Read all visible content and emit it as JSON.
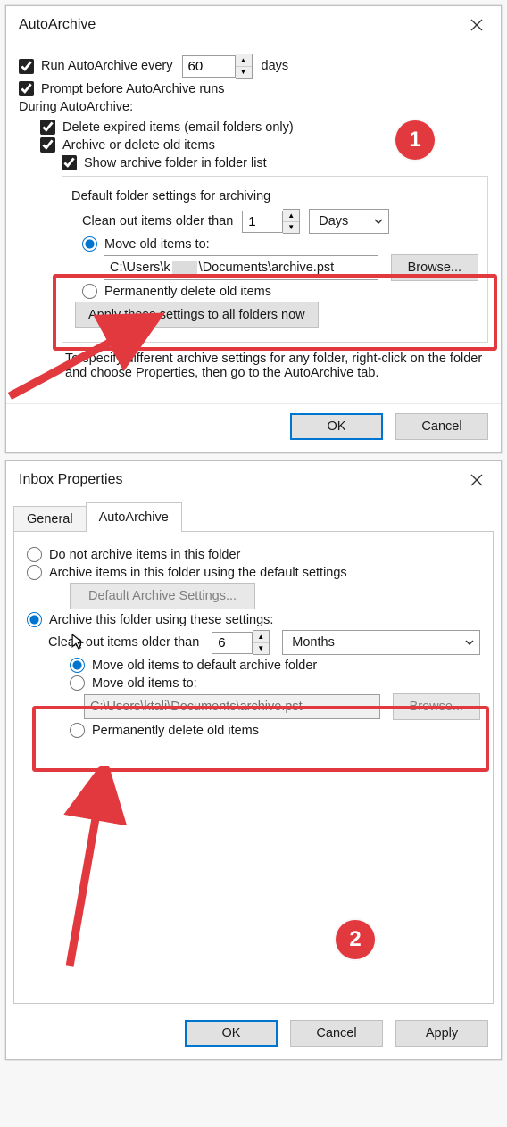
{
  "d1": {
    "title": "AutoArchive",
    "run_every_label": "Run AutoArchive every",
    "run_every_value": "60",
    "days_label": "days",
    "prompt_label": "Prompt before AutoArchive runs",
    "during_label": "During AutoArchive:",
    "delete_expired_label": "Delete expired items (email folders only)",
    "archive_old_label": "Archive or delete old items",
    "show_folder_label": "Show archive folder in folder list",
    "default_settings_header": "Default folder settings for archiving",
    "clean_out_label": "Clean out items older than",
    "clean_out_value": "1",
    "clean_out_unit": "Days",
    "move_to_label": "Move old items to:",
    "move_to_path_a": "C:\\Users\\k",
    "move_to_path_b": "\\Documents\\archive.pst",
    "browse_label": "Browse...",
    "perm_delete_label": "Permanently delete old items",
    "apply_all_label": "Apply these settings to all folders now",
    "hint": "To specify different archive settings for any folder, right-click on the folder and choose Properties, then go to the AutoArchive tab.",
    "ok": "OK",
    "cancel": "Cancel",
    "badge": "1"
  },
  "d2": {
    "title": "Inbox Properties",
    "tab_general": "General",
    "tab_auto": "AutoArchive",
    "opt_noarchive": "Do not archive items in this folder",
    "opt_default": "Archive items in this folder using the default settings",
    "default_btn": "Default Archive Settings...",
    "opt_these": "Archive this folder using these settings:",
    "clean_out_label": "Clean out items older than",
    "clean_out_value": "6",
    "clean_out_unit": "Months",
    "move_default_label": "Move old items to default archive folder",
    "move_to_label": "Move old items to:",
    "move_to_path": "C:\\Users\\ktali\\Documents\\archive.pst",
    "browse": "Browse...",
    "perm_delete_label": "Permanently delete old items",
    "ok": "OK",
    "cancel": "Cancel",
    "apply": "Apply",
    "badge": "2"
  }
}
